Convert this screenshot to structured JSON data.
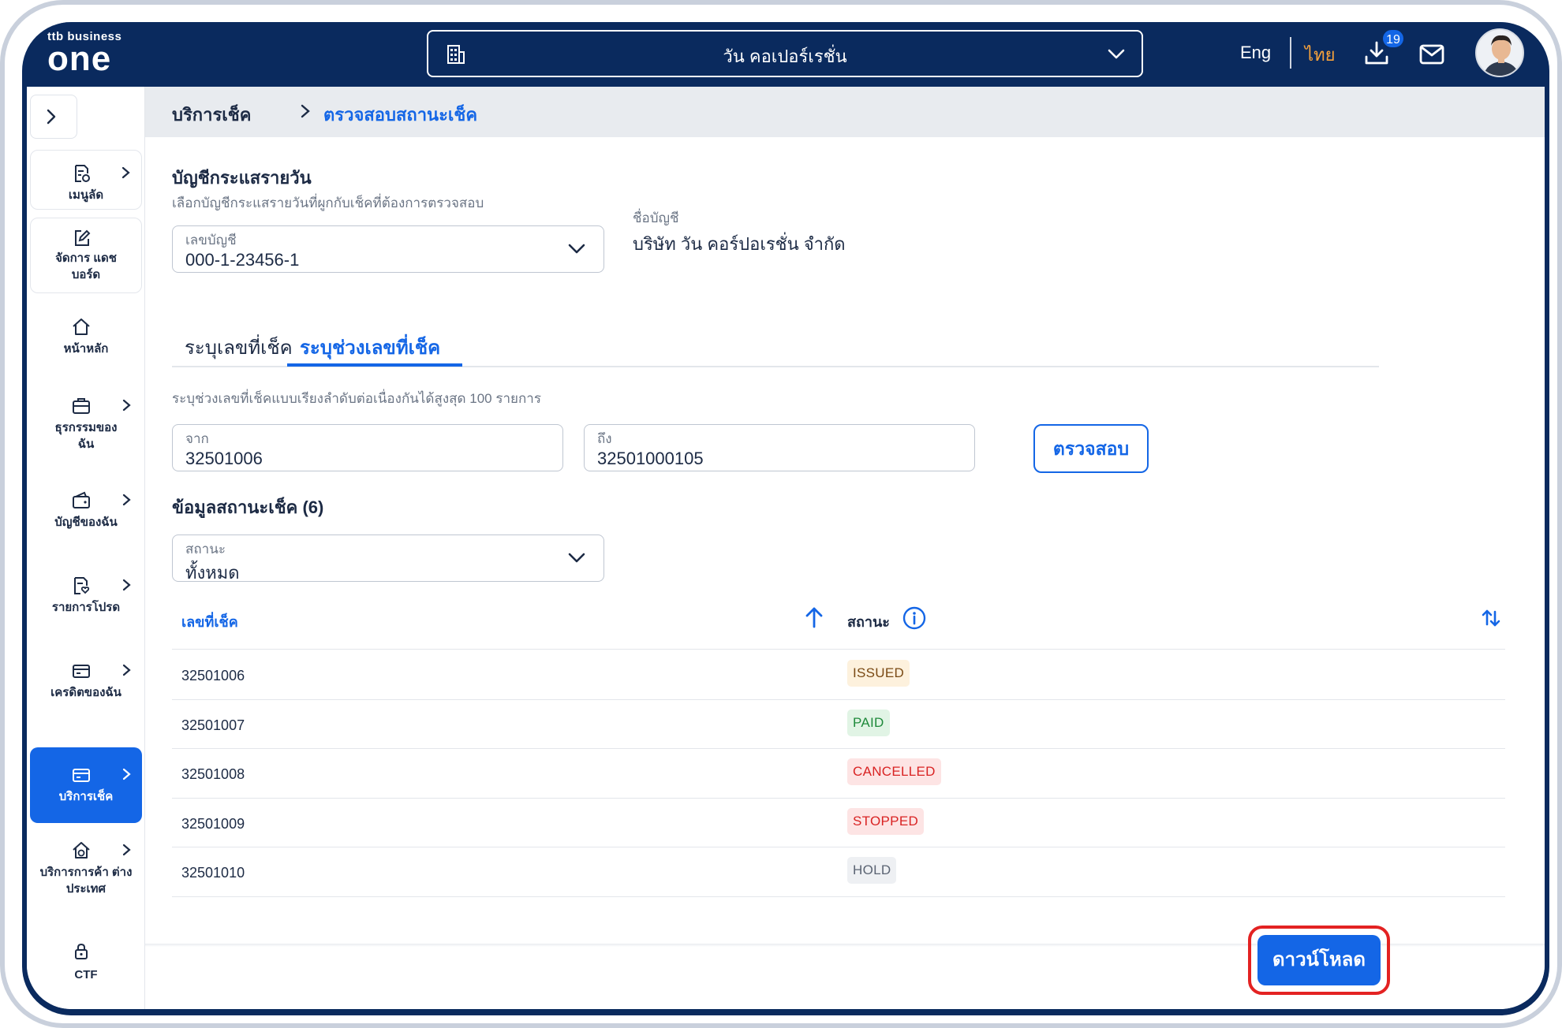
{
  "header": {
    "logo_small": "ttb business",
    "logo_big": "one",
    "company": "วัน คอเปอร์เรชั่น",
    "lang_en": "Eng",
    "lang_th": "ไทย",
    "download_count": "19"
  },
  "sidebar": {
    "items": [
      {
        "label": "เมนูลัด",
        "icon": "document-shortcut-icon"
      },
      {
        "label": "จัดการ แดชบอร์ด",
        "icon": "edit-icon"
      },
      {
        "label": "หน้าหลัก",
        "icon": "home-icon"
      },
      {
        "label": "ธุรกรรมของ ฉัน",
        "icon": "briefcase-icon"
      },
      {
        "label": "บัญชีของฉัน",
        "icon": "wallet-icon"
      },
      {
        "label": "รายการโปรด",
        "icon": "favorite-list-icon"
      },
      {
        "label": "เครดิตของฉัน",
        "icon": "credit-card-icon"
      },
      {
        "label": "บริการเช็ค",
        "icon": "cheque-icon"
      },
      {
        "label": "บริการการค้า ต่างประเทศ",
        "icon": "trade-icon"
      },
      {
        "label": "CTF",
        "icon": "lock-icon"
      }
    ]
  },
  "breadcrumb": {
    "parent": "บริการเช็ค",
    "current": "ตรวจสอบสถานะเช็ค"
  },
  "account": {
    "title": "บัญชีกระแสรายวัน",
    "subtitle": "เลือกบัญชีกระแสรายวันที่ผูกกับเช็คที่ต้องการตรวจสอบ",
    "number_label": "เลขบัญชี",
    "number_value": "000-1-23456-1",
    "name_label": "ชื่อบัญชี",
    "name_value": "บริษัท วัน คอร์ปอเรชั่น จำกัด"
  },
  "tabs": [
    {
      "label": "ระบุเลขที่เช็ค"
    },
    {
      "label": "ระบุช่วงเลขที่เช็ค"
    }
  ],
  "range": {
    "hint": "ระบุช่วงเลขที่เช็คแบบเรียงลำดับต่อเนื่องกันได้สูงสุด 100 รายการ",
    "from_label": "จาก",
    "from_value": "32501006",
    "to_label": "ถึง",
    "to_value": "32501000105",
    "verify_label": "ตรวจสอบ"
  },
  "status_section": {
    "title": "ข้อมูลสถานะเช็ค (6)",
    "filter_label": "สถานะ",
    "filter_value": "ทั้งหมด"
  },
  "table": {
    "col_number": "เลขที่เช็ค",
    "col_status": "สถานะ",
    "rows": [
      {
        "number": "32501006",
        "status": "ISSUED",
        "fg": "#7a4a14",
        "bg": "#fdf1dd"
      },
      {
        "number": "32501007",
        "status": "PAID",
        "fg": "#1f8a3b",
        "bg": "#e1f4e5"
      },
      {
        "number": "32501008",
        "status": "CANCELLED",
        "fg": "#d92323",
        "bg": "#fde4e4"
      },
      {
        "number": "32501009",
        "status": "STOPPED",
        "fg": "#d92323",
        "bg": "#fde4e4"
      },
      {
        "number": "32501010",
        "status": "HOLD",
        "fg": "#5b6473",
        "bg": "#eef0f3"
      }
    ]
  },
  "footer": {
    "download_label": "ดาวน์โหลด"
  },
  "colors": {
    "navy": "#0a2a5e",
    "primary": "#1466e6",
    "accent_orange": "#f7a23b",
    "highlight_red": "#e32222"
  }
}
